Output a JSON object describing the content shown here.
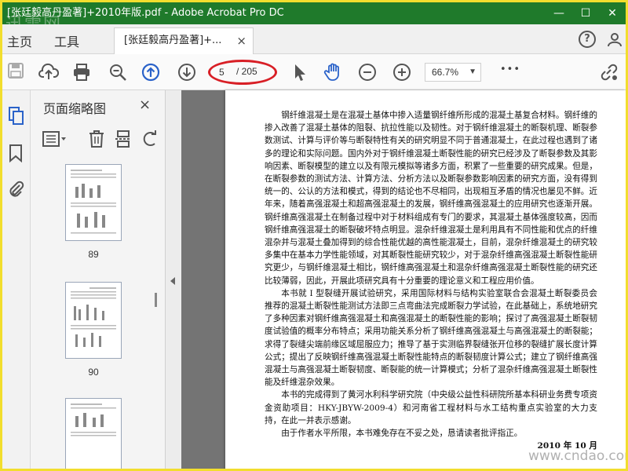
{
  "window": {
    "title": "[张廷毅高丹盈著]+2010年版.pdf - Adobe Acrobat Pro DC",
    "watermark_top": "迅雷网"
  },
  "menu": {
    "home": "主页",
    "tools": "工具",
    "document_tab": "[张廷毅高丹盈著]+...",
    "tab_close": "×",
    "help_glyph": "?"
  },
  "toolbar": {
    "current_page": "5",
    "total_pages": "/ 205",
    "zoom": "66.7%",
    "more_glyph": "•••"
  },
  "thumbnail_panel": {
    "title": "页面缩略图",
    "close_glyph": "×",
    "pages": [
      "89",
      "90"
    ]
  },
  "document": {
    "paragraphs": [
      "钢纤维混凝土是在混凝土基体中掺入适量钢纤维所形成的混凝土基复合材料。钢纤维的掺入改善了混凝土基体的阻裂、抗拉性能以及韧性。对于钢纤维混凝土的断裂机理、断裂参数测试、计算与评价等与断裂特性有关的研究明显不同于普通混凝土，在此过程也遇到了诸多的理论和实际问题。国内外对于钢纤维混凝土断裂性能的研究已经涉及了断裂参数及其影响因素、断裂模型的建立以及有限元模拟等诸多方面，积累了一些重要的研究成果。但是，在断裂参数的测试方法、计算方法、分析方法以及断裂参数影响因素的研究方面，没有得到统一的、公认的方法和模式，得到的结论也不尽相同，出现相互矛盾的情况也屡见不鲜。近年来，随着高强混凝土和超高强混凝土的发展，钢纤维高强混凝土的应用研究也逐渐开展。钢纤维高强混凝土在制备过程中对于材料组成有专门的要求，其混凝土基体强度较高，因而钢纤维高强混凝土的断裂破坏特点明显。混杂纤维混凝土是利用具有不同性能和优点的纤维混杂并与混凝土叠加得到的综合性能优越的高性能混凝土，目前，混杂纤维混凝土的研究较多集中在基本力学性能领域，对其断裂性能研究较少，对于混杂纤维高强混凝土断裂性能研究更少，与钢纤维混凝土相比，钢纤维高强混凝土和混杂纤维高强混凝土断裂性能的研究还比较薄弱，因此，开展此项研究具有十分重要的理论意义和工程应用价值。",
      "本书就 I 型裂缝开展试验研究，采用国际材料与结构实验室联合会混凝土断裂委员会推荐的混凝土断裂性能测试方法即三点弯曲法完成断裂力学试验，在此基础上，系统地研究了多种因素对钢纤维高强混凝土和高强混凝土的断裂性能的影响；探讨了高强混凝土断裂韧度试验值的概率分布特点；采用功能关系分析了钢纤维高强混凝土与高强混凝土的断裂能；求得了裂缝尖端前缘区域屈服应力；推导了基于实测临界裂缝张开位移的裂缝扩展长度计算公式；提出了反映钢纤维高强混凝土断裂性能特点的断裂韧度计算公式；建立了钢纤维高强混凝土与高强混凝土断裂韧度、断裂能的统一计算模式；分析了混杂纤维高强混凝土断裂性能及纤维混杂效果。",
      "本书的完成得到了黄河水利科学研究院（中央级公益性科研院所基本科研业务费专项资金资助项目：HKY-JBYW-2009-4）和河南省工程材料与水工结构重点实验室的大力支持，在此一并表示感谢。",
      "由于作者水平所限，本书难免存在不妥之处，恳请读者批评指正。"
    ],
    "signature": "2010 年 10 月",
    "watermark_bottom": "www.cndao.com"
  },
  "colors": {
    "titlebar": "#1f7a2b",
    "highlight_circle": "#d81f26",
    "accent_blue": "#2a62c9",
    "frame_yellow": "#f2de2e"
  }
}
